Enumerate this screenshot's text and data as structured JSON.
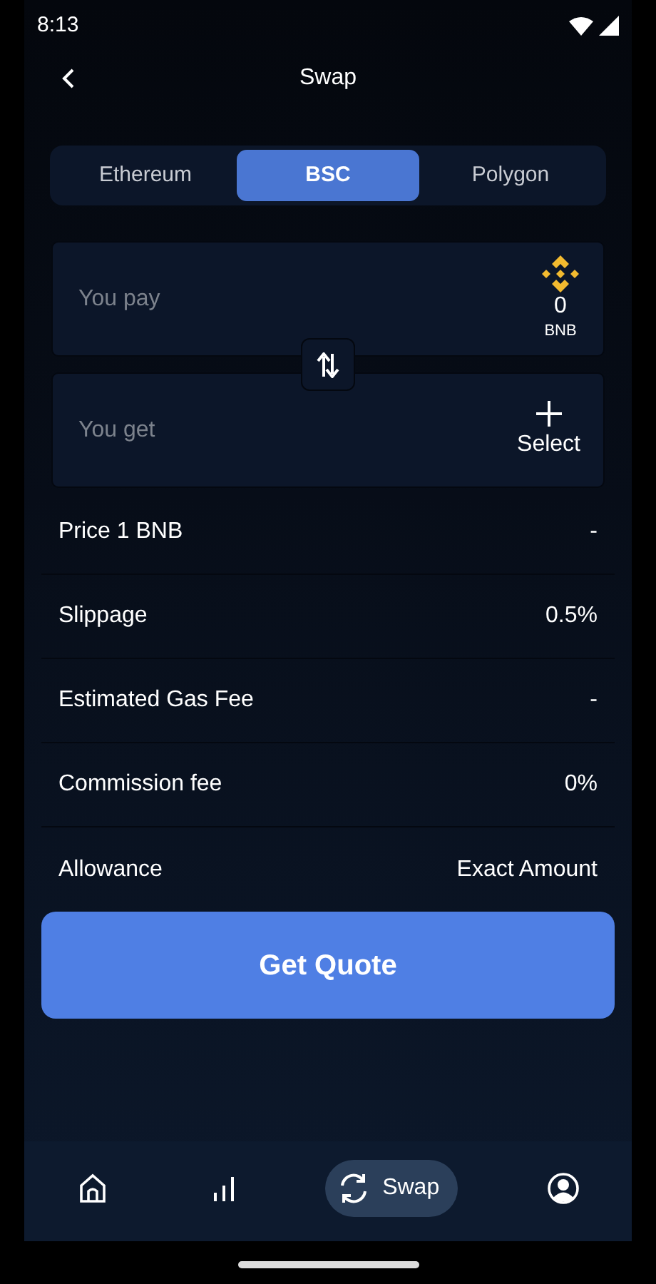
{
  "status_bar": {
    "time": "8:13"
  },
  "header": {
    "title": "Swap"
  },
  "networks": [
    {
      "label": "Ethereum",
      "selected": false
    },
    {
      "label": "BSC",
      "selected": true
    },
    {
      "label": "Polygon",
      "selected": false
    }
  ],
  "pay": {
    "placeholder": "You pay",
    "amount": "0",
    "token": "BNB"
  },
  "get": {
    "placeholder": "You get",
    "action": "Select"
  },
  "details": [
    {
      "label": "Price 1 BNB",
      "value": "-"
    },
    {
      "label": "Slippage",
      "value": "0.5%"
    },
    {
      "label": "Estimated Gas Fee",
      "value": "-"
    },
    {
      "label": "Commission fee",
      "value": "0%"
    },
    {
      "label": "Allowance",
      "value": "Exact Amount"
    }
  ],
  "primary_button": "Get Quote",
  "bottom_nav": [
    {
      "kind": "home",
      "selected": false
    },
    {
      "kind": "chart",
      "selected": false
    },
    {
      "kind": "swap",
      "label": "Swap",
      "selected": true
    },
    {
      "kind": "profile",
      "selected": false
    }
  ]
}
